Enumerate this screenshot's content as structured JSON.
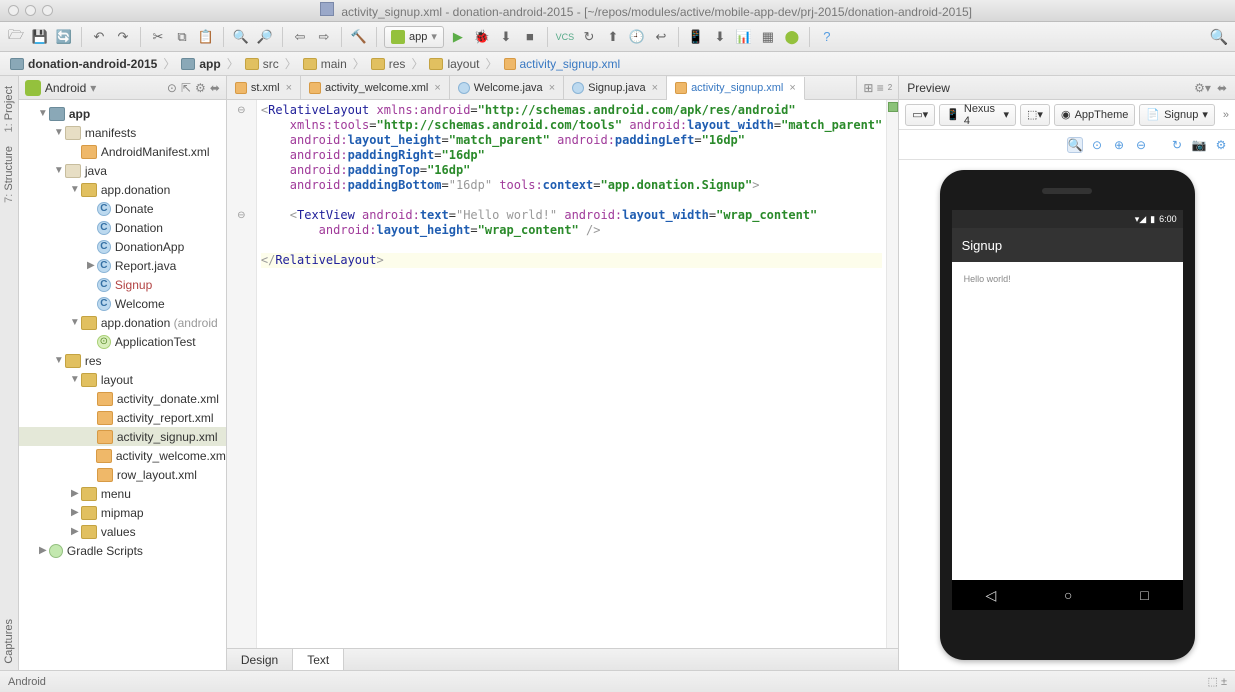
{
  "window": {
    "title": "activity_signup.xml - donation-android-2015 - [~/repos/modules/active/mobile-app-dev/prj-2015/donation-android-2015]"
  },
  "runConfig": {
    "label": "app"
  },
  "breadcrumb": {
    "items": [
      "donation-android-2015",
      "app",
      "src",
      "main",
      "res",
      "layout",
      "activity_signup.xml"
    ]
  },
  "sideTabs": {
    "project": "1: Project",
    "structure": "7: Structure",
    "captures": "Captures"
  },
  "projectPanel": {
    "header": "Android",
    "tree": {
      "app": "app",
      "manifests": "manifests",
      "androidManifest": "AndroidManifest.xml",
      "java": "java",
      "pkg1": "app.donation",
      "pkg1_items": [
        "Donate",
        "Donation",
        "DonationApp",
        "Report.java",
        "Signup",
        "Welcome"
      ],
      "pkg2": "app.donation",
      "pkg2_suffix": "(android",
      "pkg2_items": [
        "ApplicationTest"
      ],
      "res": "res",
      "layout": "layout",
      "layouts": [
        "activity_donate.xml",
        "activity_report.xml",
        "activity_signup.xml",
        "activity_welcome.xm",
        "row_layout.xml"
      ],
      "menu": "menu",
      "mipmap": "mipmap",
      "values": "values",
      "gradle": "Gradle Scripts"
    }
  },
  "editorTabs": {
    "t0": "st.xml",
    "t1": "activity_welcome.xml",
    "t2": "Welcome.java",
    "t3": "Signup.java",
    "t4": "activity_signup.xml"
  },
  "editorBottom": {
    "design": "Design",
    "text": "Text"
  },
  "code": {
    "l1a": "<",
    "l1b": "RelativeLayout",
    "l1c": " xmlns:",
    "l1d": "android",
    "l1e": "=",
    "l1f": "\"http://schemas.android.com/apk/res/android\"",
    "l2a": "    xmlns:",
    "l2b": "tools",
    "l2c": "=",
    "l2d": "\"http://schemas.android.com/tools\"",
    "l2e": " android:",
    "l2f": "layout_width",
    "l2g": "=",
    "l2h": "\"match_parent\"",
    "l3a": "    android:",
    "l3b": "layout_height",
    "l3c": "=",
    "l3d": "\"match_parent\"",
    "l3e": " android:",
    "l3f": "paddingLeft",
    "l3g": "=",
    "l3h": "\"16dp\"",
    "l4a": "    android:",
    "l4b": "paddingRight",
    "l4c": "=",
    "l4d": "\"16dp\"",
    "l5a": "    android:",
    "l5b": "paddingTop",
    "l5c": "=",
    "l5d": "\"16dp\"",
    "l6a": "    android:",
    "l6b": "paddingBottom",
    "l6c": "=",
    "l6d": "\"16dp\"",
    "l6e": " tools:",
    "l6f": "context",
    "l6g": "=",
    "l6h": "\"app.donation.Signup\"",
    "l6i": ">",
    "l8a": "    <",
    "l8b": "TextView",
    "l8c": " android:",
    "l8d": "text",
    "l8e": "=",
    "l8f": "\"Hello world!\"",
    "l8g": " android:",
    "l8h": "layout_width",
    "l8i": "=",
    "l8j": "\"wrap_content\"",
    "l9a": "        android:",
    "l9b": "layout_height",
    "l9c": "=",
    "l9d": "\"wrap_content\"",
    "l9e": " />",
    "l11a": "</",
    "l11b": "RelativeLayout",
    "l11c": ">"
  },
  "preview": {
    "title": "Preview",
    "device": "Nexus 4",
    "theme": "AppTheme",
    "activity": "Signup",
    "statusTime": "6:00",
    "appbarTitle": "Signup",
    "bodyText": "Hello world!"
  },
  "status": {
    "mode": "Android"
  }
}
